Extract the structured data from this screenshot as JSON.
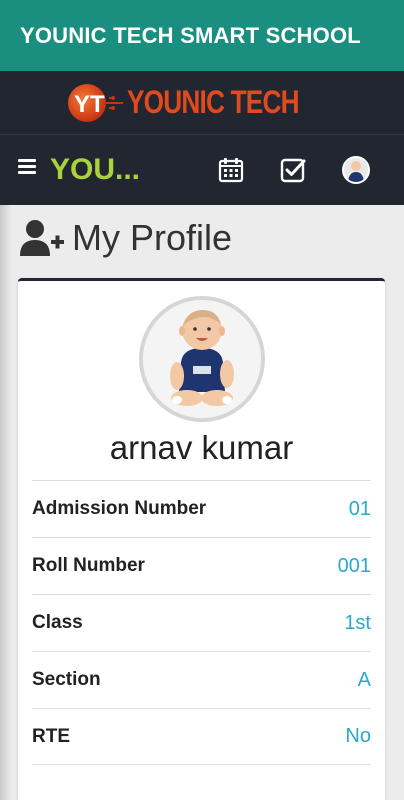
{
  "appbar": {
    "title": "YOUNIC TECH SMART SCHOOL"
  },
  "brand": {
    "logo_text": "YOUNIC TECH",
    "logo_color": "#e14a1d"
  },
  "navbar": {
    "brand_text": "YOU...",
    "menu_icon": "hamburger-menu-icon",
    "icons": [
      "calendar-icon",
      "checkbox-icon",
      "user-avatar-icon"
    ]
  },
  "page": {
    "title": "My Profile",
    "title_icon": "user-plus-icon"
  },
  "profile": {
    "name": "arnav kumar",
    "fields": [
      {
        "label": "Admission Number",
        "value": "01"
      },
      {
        "label": "Roll Number",
        "value": "001"
      },
      {
        "label": "Class",
        "value": "1st"
      },
      {
        "label": "Section",
        "value": "A"
      },
      {
        "label": "RTE",
        "value": "No"
      }
    ]
  },
  "colors": {
    "appbar": "#1a8f7f",
    "navbar": "#222631",
    "brand_accent": "#a9d33a",
    "value_text": "#2aa9c9"
  }
}
